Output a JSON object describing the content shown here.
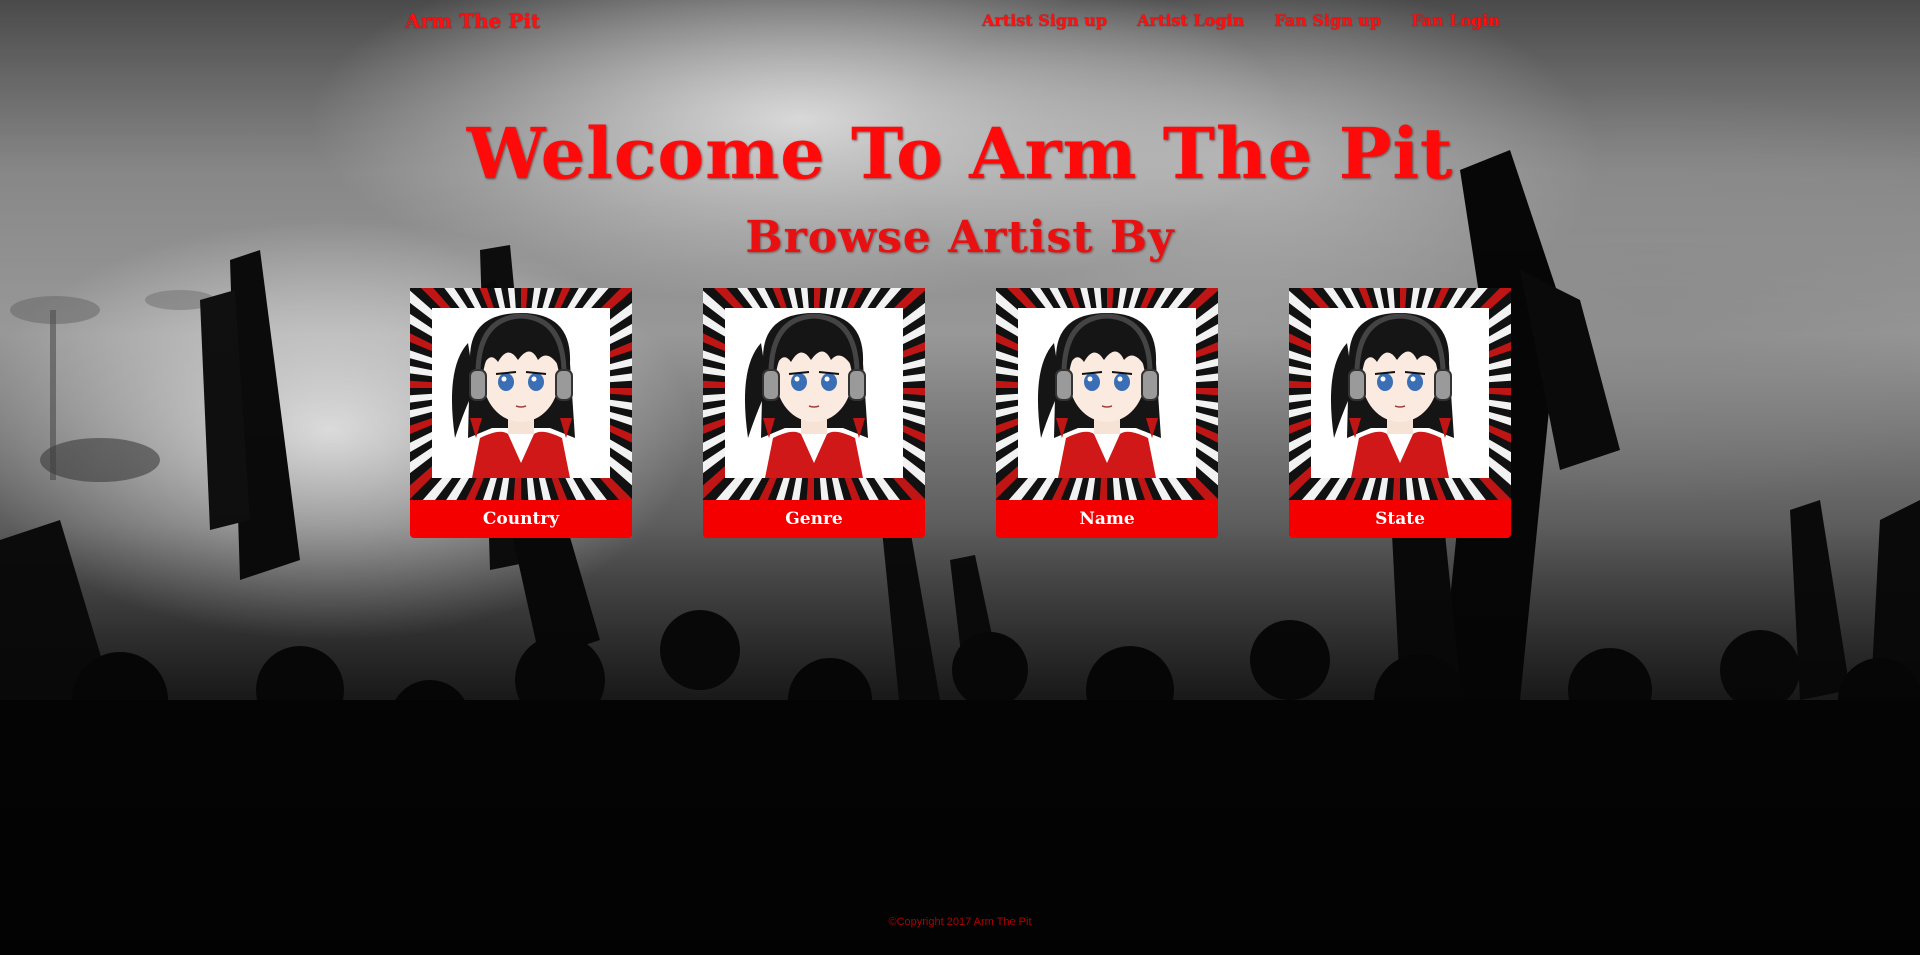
{
  "nav": {
    "brand": "Arm The Pit",
    "links": [
      {
        "label": "Artist Sign up"
      },
      {
        "label": "Artist Login"
      },
      {
        "label": "Fan Sign up"
      },
      {
        "label": "Fan Login"
      }
    ]
  },
  "hero": {
    "title": "Welcome To Arm The Pit",
    "subtitle": "Browse Artist By"
  },
  "cards": [
    {
      "label": "Country",
      "icon": "anime-girl-headphones-avatar"
    },
    {
      "label": "Genre",
      "icon": "anime-girl-headphones-avatar"
    },
    {
      "label": "Name",
      "icon": "anime-girl-headphones-avatar"
    },
    {
      "label": "State",
      "icon": "anime-girl-headphones-avatar"
    }
  ],
  "footer": {
    "copyright": "©Copyright 2017 Arm The Pit"
  },
  "colors": {
    "accent": "#ff0a0a",
    "card_label_bg": "#f40000",
    "card_label_text": "#ffffff"
  }
}
